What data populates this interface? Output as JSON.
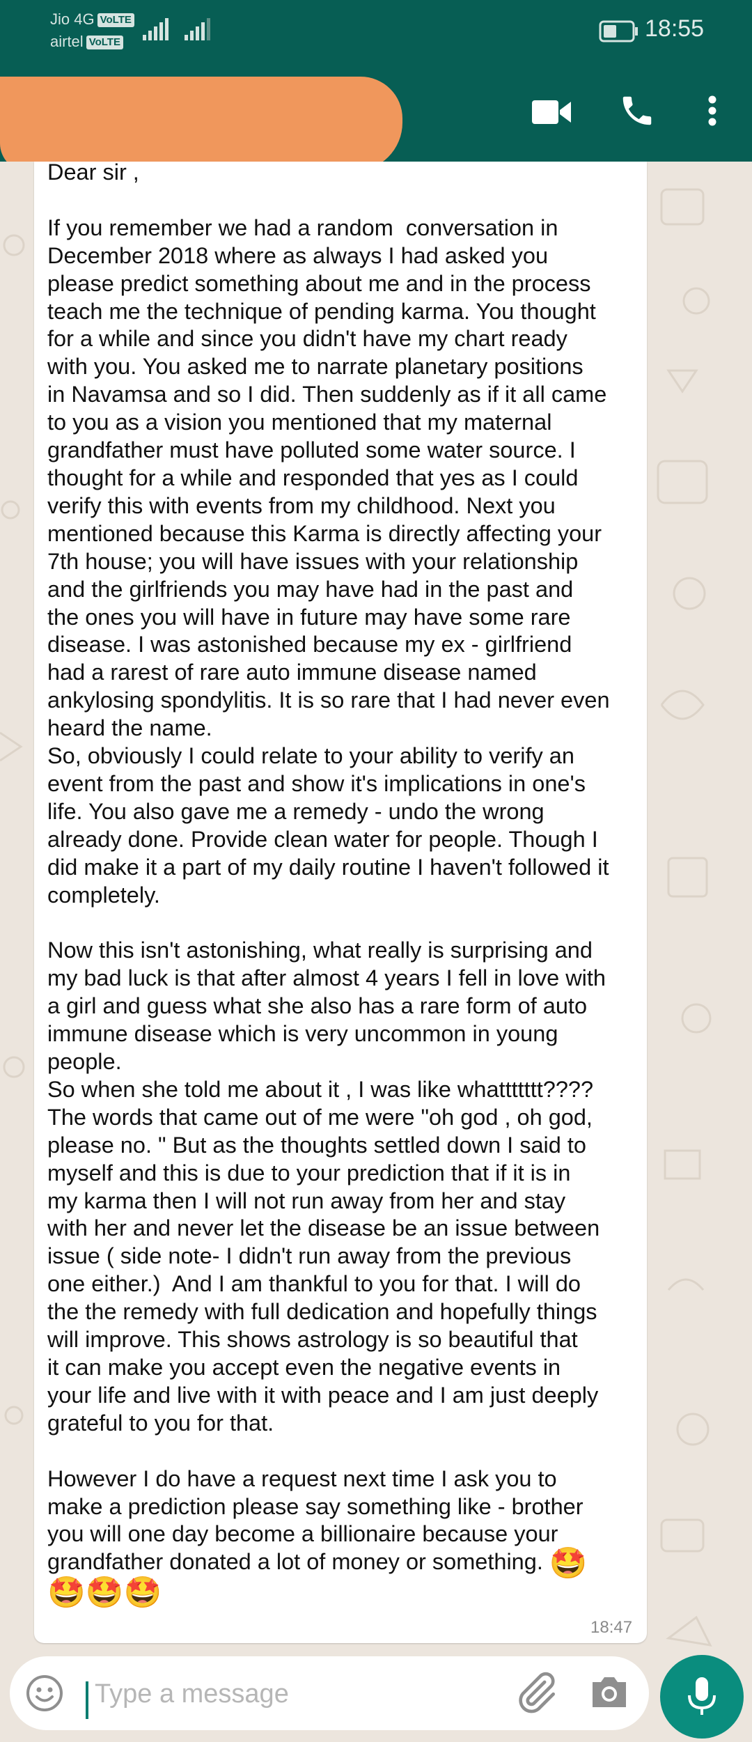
{
  "status_bar": {
    "carrier_1": "Jio 4G",
    "carrier_1_badge": "VoLTE",
    "carrier_2": "airtel",
    "carrier_2_badge": "VoLTE",
    "time": "18:55"
  },
  "chat_header": {
    "icons": [
      "video-call-icon",
      "voice-call-icon",
      "more-options-icon"
    ]
  },
  "message": {
    "text": "Dear sir ,\n\nIf you remember we had a random  conversation in\nDecember 2018 where as always I had asked you\nplease predict something about me and in the process\nteach me the technique of pending karma. You thought\nfor a while and since you didn't have my chart ready\nwith you. You asked me to narrate planetary positions\nin Navamsa and so I did. Then suddenly as if it all came\nto you as a vision you mentioned that my maternal\ngrandfather must have polluted some water source. I\nthought for a while and responded that yes as I could\nverify this with events from my childhood. Next you\nmentioned because this Karma is directly affecting your\n7th house; you will have issues with your relationship\nand the girlfriends you may have had in the past and\nthe ones you will have in future may have some rare\ndisease. I was astonished because my ex - girlfriend\nhad a rarest of rare auto immune disease named\nankylosing spondylitis. It is so rare that I had never even\nheard the name.\nSo, obviously I could relate to your ability to verify an\nevent from the past and show it's implications in one's\nlife. You also gave me a remedy - undo the wrong\nalready done. Provide clean water for people. Though I\ndid make it a part of my daily routine I haven't followed it\ncompletely.\n\nNow this isn't astonishing, what really is surprising and\nmy bad luck is that after almost 4 years I fell in love with\na girl and guess what she also has a rare form of auto\nimmune disease which is very uncommon in young\npeople.\nSo when she told me about it , I was like whattttttt????\nThe words that came out of me were \"oh god , oh god,\nplease no. \" But as the thoughts settled down I said to\nmyself and this is due to your prediction that if it is in\nmy karma then I will not run away from her and stay\nwith her and never let the disease be an issue between\nissue ( side note- I didn't run away from the previous\none either.)  And I am thankful to you for that. I will do\nthe the remedy with full dedication and hopefully things\nwill improve. This shows astrology is so beautiful that\nit can make you accept even the negative events in\nyour life and live with it with peace and I am just deeply\ngrateful to you for that.\n\nHowever I do have a request next time I ask you to\nmake a prediction please say something like - brother\nyou will one day become a billionaire because your\ngrandfather donated a lot of money or something. ",
    "emoji_inline": "🤩",
    "emoji_row": "🤩🤩🤩",
    "time": "18:47"
  },
  "composer": {
    "placeholder": "Type a message",
    "icons": [
      "emoji-icon",
      "attach-icon",
      "camera-icon",
      "mic-icon"
    ]
  },
  "colors": {
    "header": "#075e54",
    "mic_button": "#0a8d7e",
    "wallpaper": "#ece5dd",
    "redaction": "#f0975c"
  }
}
